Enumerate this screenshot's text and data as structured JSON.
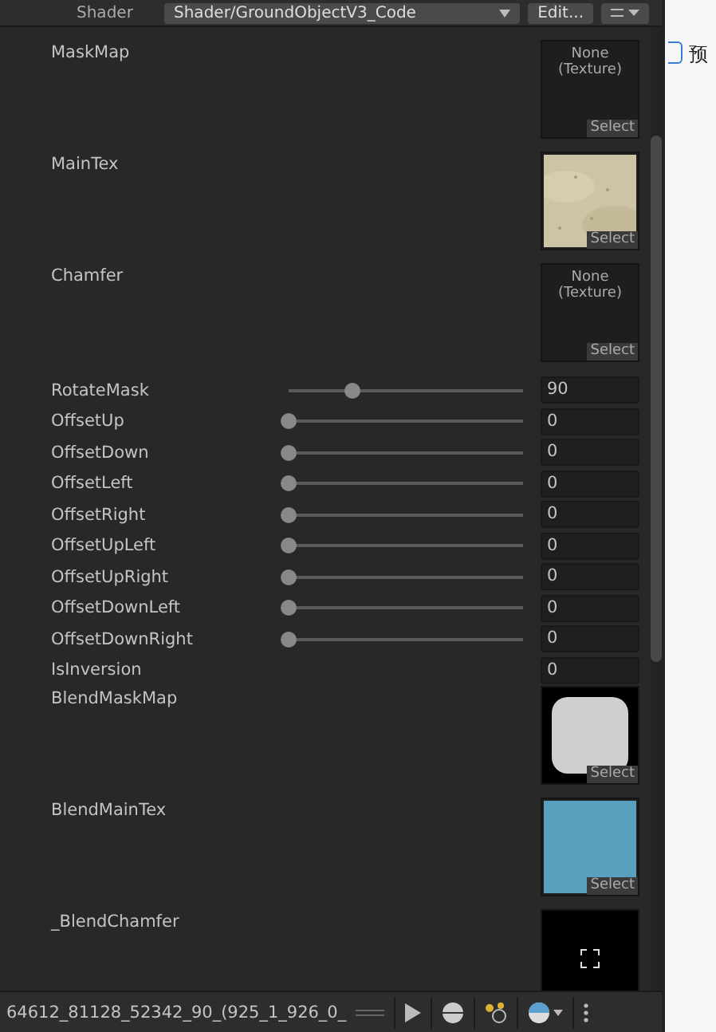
{
  "header": {
    "label": "Shader",
    "shader": "Shader/GroundObjectV3_Code",
    "edit": "Edit..."
  },
  "properties": [
    {
      "kind": "texture",
      "label": "MaskMap",
      "preview": {
        "kind": "empty",
        "text": "None\n(Texture)"
      },
      "select": "Select"
    },
    {
      "kind": "texture",
      "label": "MainTex",
      "select": "Select"
    },
    {
      "kind": "texture",
      "label": "Chamfer",
      "preview": {
        "kind": "empty",
        "text": "None\n(Texture)"
      },
      "select": "Select"
    },
    {
      "kind": "slider",
      "label": "RotateMask",
      "level": 0.27,
      "value": "90"
    },
    {
      "kind": "slider",
      "label": "OffsetUp",
      "level": 0,
      "value": "0"
    },
    {
      "kind": "slider",
      "label": "OffsetDown",
      "level": 0,
      "value": "0"
    },
    {
      "kind": "slider",
      "label": "OffsetLeft",
      "level": 0,
      "value": "0"
    },
    {
      "kind": "slider",
      "label": "OffsetRight",
      "level": 0,
      "value": "0"
    },
    {
      "kind": "slider",
      "label": "OffsetUpLeft",
      "level": 0,
      "value": "0"
    },
    {
      "kind": "slider",
      "label": "OffsetUpRight",
      "level": 0,
      "value": "0"
    },
    {
      "kind": "slider",
      "label": "OffsetDownLeft",
      "level": 0,
      "value": "0"
    },
    {
      "kind": "slider",
      "label": "OffsetDownRight",
      "level": 0,
      "value": "0"
    },
    {
      "kind": "number",
      "label": "IsInversion",
      "value": "0"
    },
    {
      "kind": "texture",
      "label": "BlendMaskMap",
      "preview": {
        "kind": "rounded-square"
      },
      "select": "Select"
    },
    {
      "kind": "texture",
      "label": "BlendMainTex",
      "preview": {
        "kind": "swatch",
        "color": "#5a9fbd"
      },
      "select": "Select"
    },
    {
      "kind": "texture",
      "label": "_BlendChamfer",
      "preview": {
        "kind": "crop-marks"
      }
    }
  ],
  "footer": {
    "asset": "64612_81128_52342_90_(925_1_926_0_"
  },
  "side": {
    "checked": false,
    "label": "预"
  }
}
